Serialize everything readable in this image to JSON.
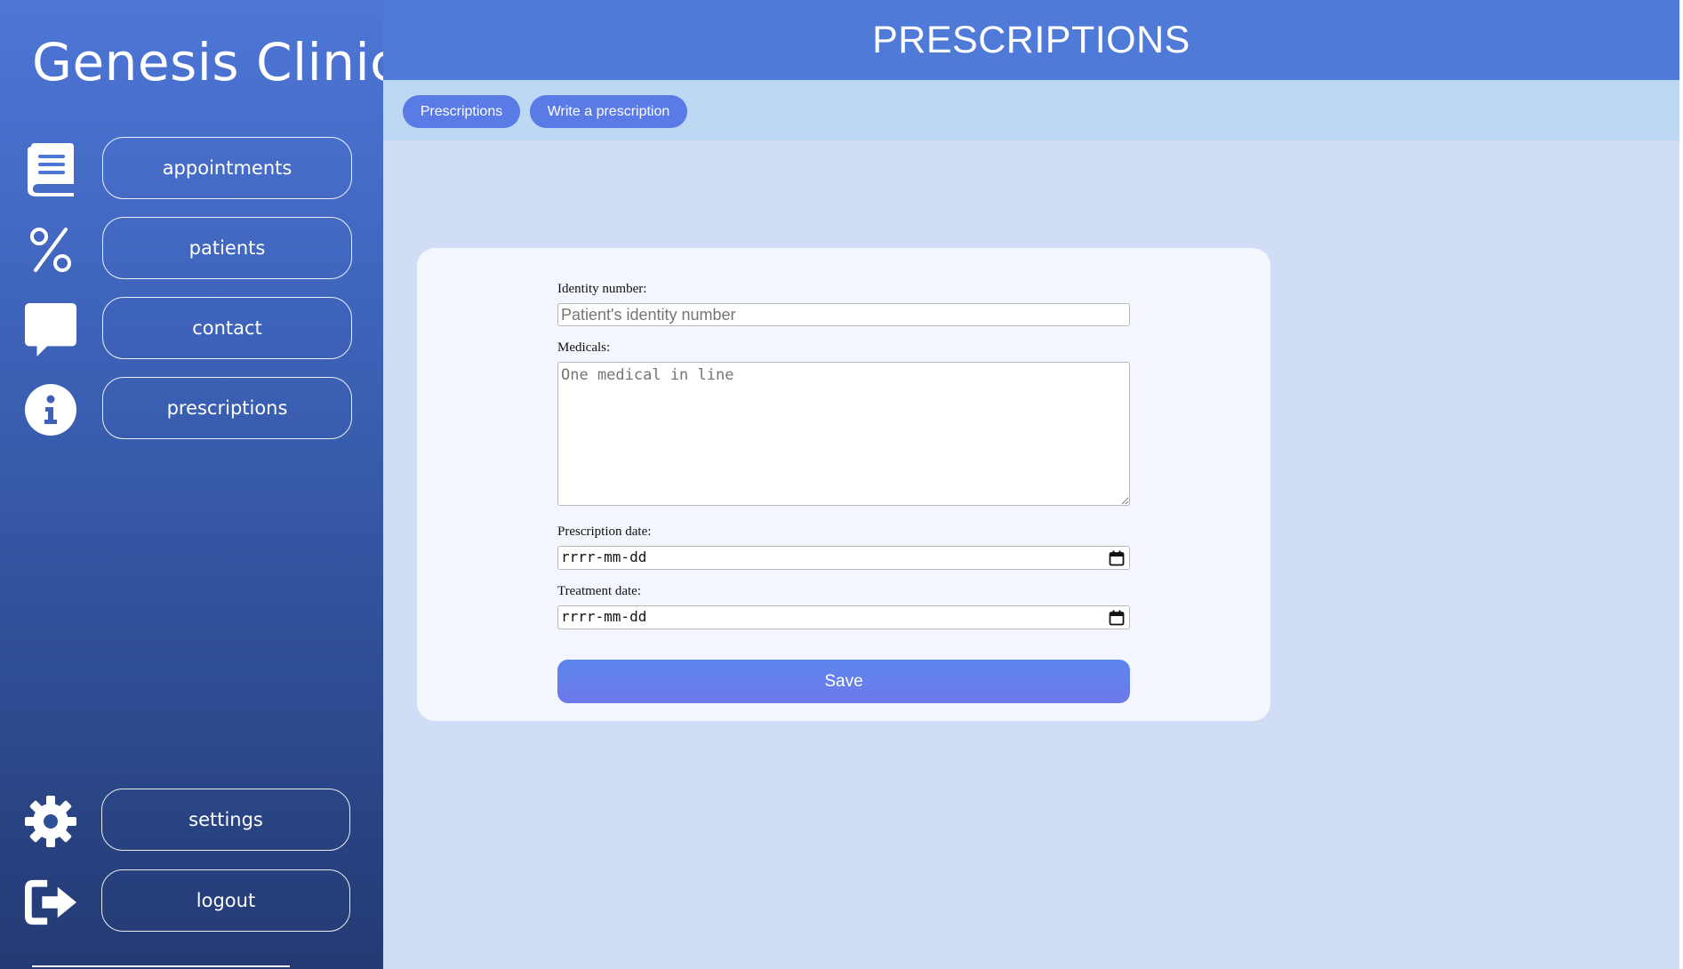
{
  "app": {
    "brand": "Genesis Clinic",
    "page_title": "PRESCRIPTIONS"
  },
  "sidebar": {
    "items": [
      {
        "label": "appointments",
        "icon": "book-icon"
      },
      {
        "label": "patients",
        "icon": "percent-icon"
      },
      {
        "label": "contact",
        "icon": "chat-bubble-icon"
      },
      {
        "label": "prescriptions",
        "icon": "info-icon"
      }
    ],
    "bottom_items": [
      {
        "label": "settings",
        "icon": "gear-icon"
      },
      {
        "label": "logout",
        "icon": "logout-icon"
      }
    ]
  },
  "tabs": {
    "prescriptions": "Prescriptions",
    "write": "Write a prescription"
  },
  "form": {
    "identity_label": "Identity number:",
    "identity_placeholder": "Patient's identity number",
    "medicals_label": "Medicals:",
    "medicals_placeholder": "One medical in line",
    "prescription_date_label": "Prescription date:",
    "prescription_date_value": "rrrr-mm-dd",
    "treatment_date_label": "Treatment date:",
    "treatment_date_value": "rrrr-mm-dd",
    "save_label": "Save"
  },
  "colors": {
    "header": "#4f7ad8",
    "tabbar": "#bcd8f2",
    "main_bg": "#d0ddf4",
    "accent": "#5a7be6"
  }
}
